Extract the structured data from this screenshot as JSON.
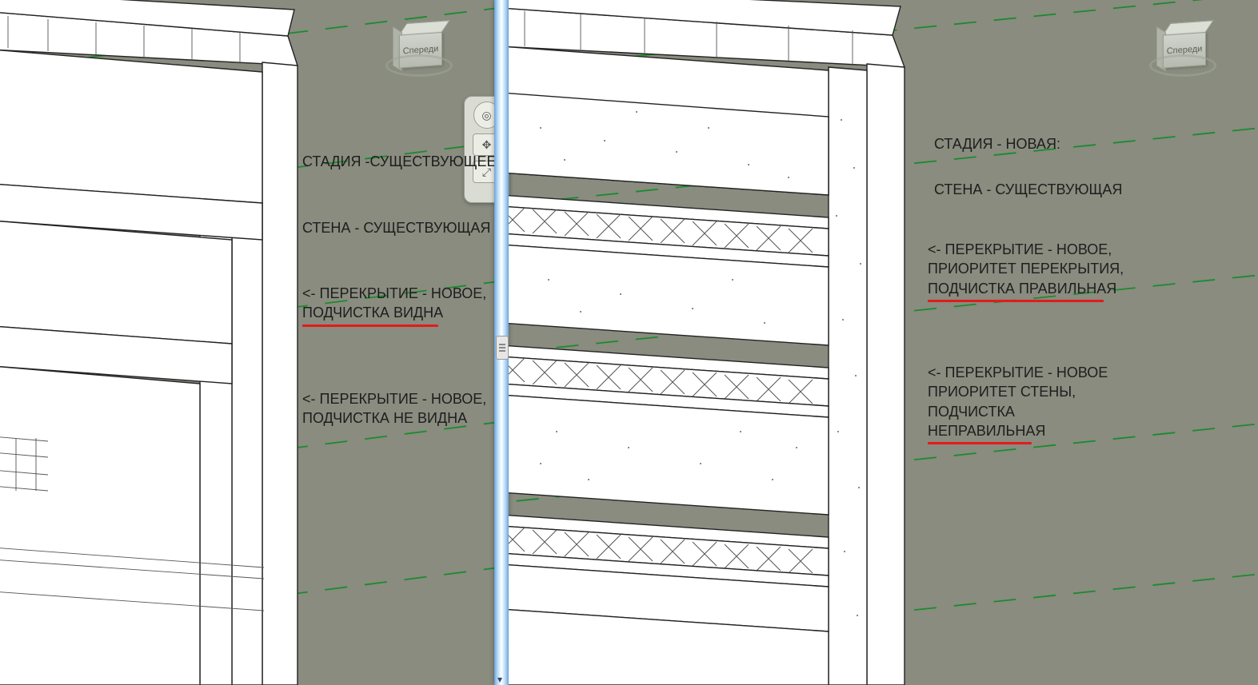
{
  "viewcube": {
    "front_label": "Спереди"
  },
  "left_pane": {
    "annotations": {
      "phase": "СТАДИЯ -СУЩЕСТВУЮЩЕЕ:",
      "wall": "СТЕНА - СУЩЕСТВУЮЩАЯ",
      "slab1_line1": "<- ПЕРЕКРЫТИЕ - НОВОЕ,",
      "slab1_line2": "ПОДЧИСТКА ВИДНА",
      "slab2_line1": "<- ПЕРЕКРЫТИЕ - НОВОЕ,",
      "slab2_line2": "ПОДЧИСТКА НЕ ВИДНА"
    }
  },
  "right_pane": {
    "annotations": {
      "phase": "СТАДИЯ - НОВАЯ:",
      "wall": "СТЕНА  - СУЩЕСТВУЮЩАЯ",
      "slab1_line1": "<- ПЕРЕКРЫТИЕ - НОВОЕ,",
      "slab1_line2": "ПРИОРИТЕТ ПЕРЕКРЫТИЯ,",
      "slab1_line3": "ПОДЧИСТКА ПРАВИЛЬНАЯ",
      "slab2_line1": "<- ПЕРЕКРЫТИЕ - НОВОЕ",
      "slab2_line2": "ПРИОРИТЕТ СТЕНЫ,",
      "slab2_line3": "ПОДЧИСТКА",
      "slab2_line4": "НЕПРАВИЛЬНАЯ"
    }
  }
}
